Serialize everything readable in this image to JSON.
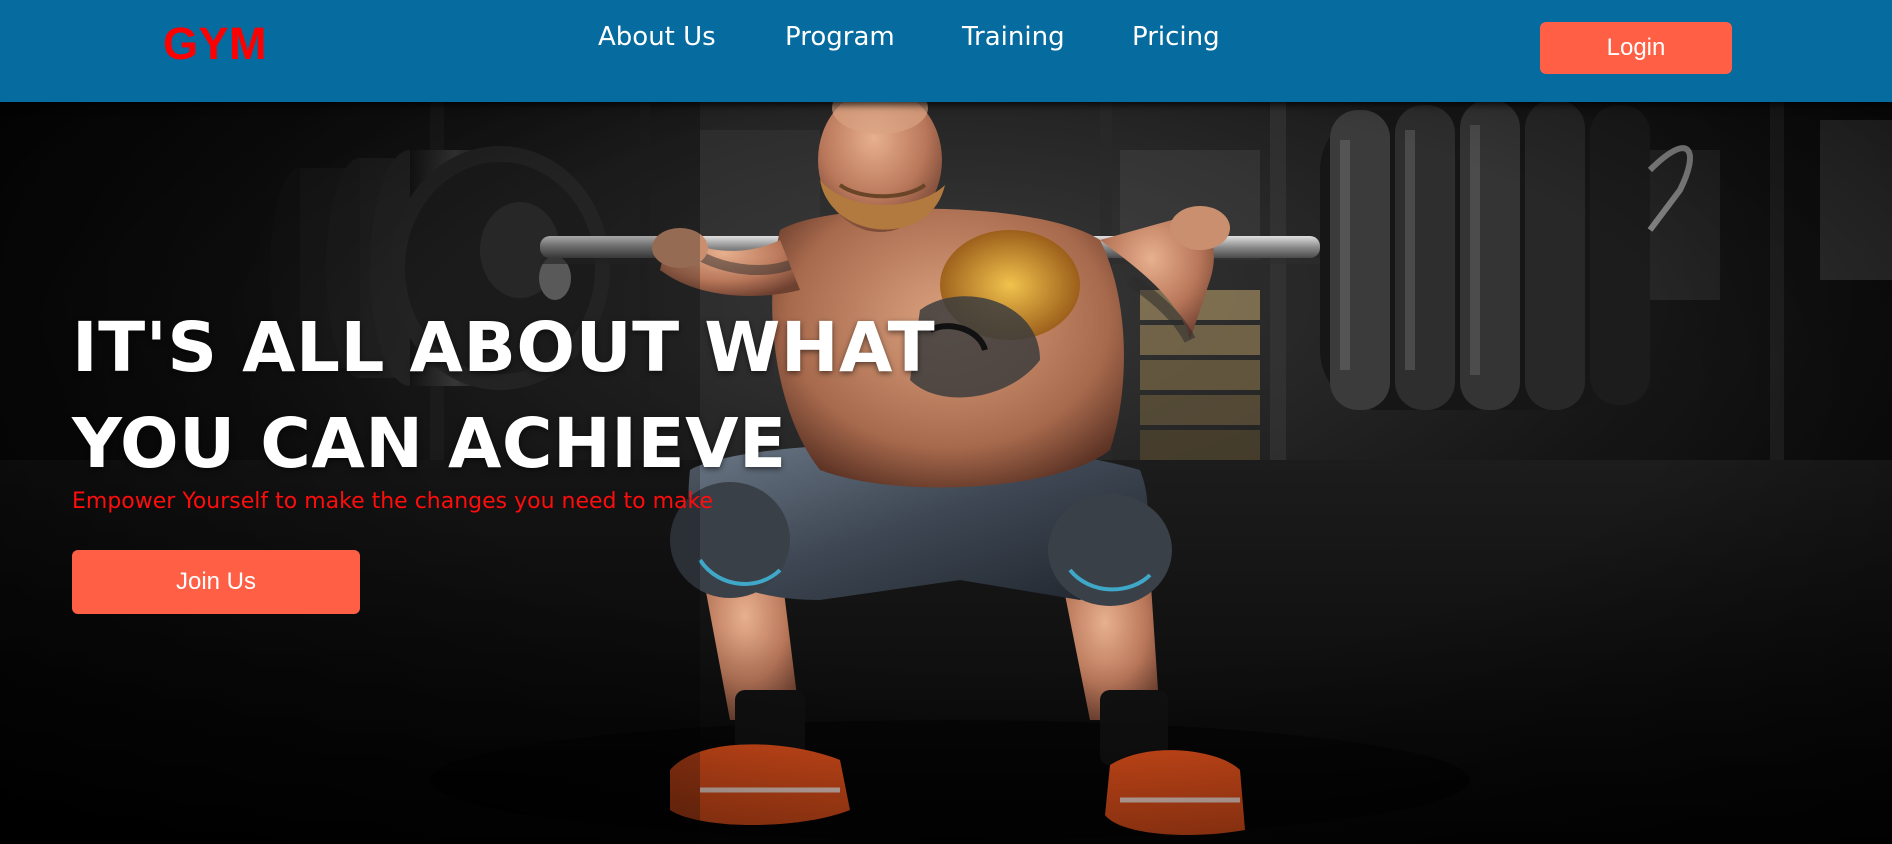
{
  "nav": {
    "logo": "GYM",
    "links": [
      "About Us",
      "Program",
      "Training",
      "Pricing"
    ],
    "login_label": "Login"
  },
  "hero": {
    "title_line1": "IT'S ALL ABOUT WHAT",
    "title_line2": "YOU CAN ACHIEVE",
    "subtitle": "Empower Yourself to make the changes you need to make",
    "cta_label": "Join Us"
  },
  "colors": {
    "navbar": "#066b9f",
    "logo": "#ff0000",
    "button": "#ff5f45",
    "subtitle": "#ff0c0c"
  }
}
